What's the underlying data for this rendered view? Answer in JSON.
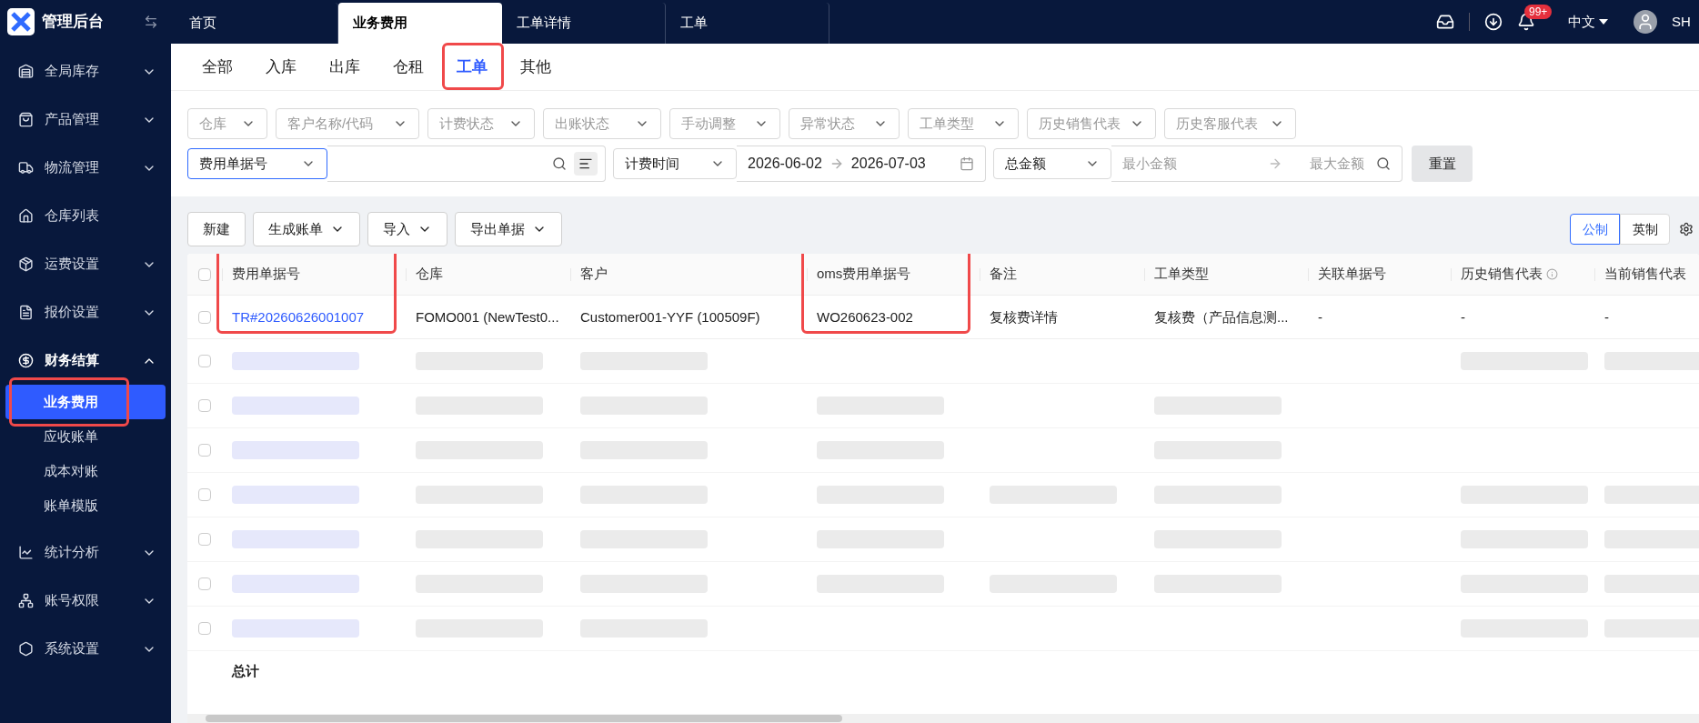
{
  "app": {
    "title": "管理后台"
  },
  "page_tabs": [
    {
      "label": "首页",
      "selected": false
    },
    {
      "label": "业务费用",
      "selected": true
    },
    {
      "label": "工单详情",
      "selected": false
    },
    {
      "label": "工单",
      "selected": false
    }
  ],
  "header": {
    "notification_count": "99+",
    "language": "中文",
    "user": "SH"
  },
  "sidebar": {
    "items": [
      {
        "label": "全局库存",
        "expandable": true,
        "expanded": false
      },
      {
        "label": "产品管理",
        "expandable": true,
        "expanded": false
      },
      {
        "label": "物流管理",
        "expandable": true,
        "expanded": false
      },
      {
        "label": "仓库列表",
        "expandable": false,
        "expanded": false
      },
      {
        "label": "运费设置",
        "expandable": true,
        "expanded": false
      },
      {
        "label": "报价设置",
        "expandable": true,
        "expanded": false
      },
      {
        "label": "财务结算",
        "expandable": true,
        "expanded": true,
        "children": [
          {
            "label": "业务费用",
            "selected": true,
            "highlighted": true
          },
          {
            "label": "应收账单",
            "selected": false,
            "highlighted": false
          },
          {
            "label": "成本对账",
            "selected": false,
            "highlighted": false
          },
          {
            "label": "账单模版",
            "selected": false,
            "highlighted": false
          }
        ]
      },
      {
        "label": "统计分析",
        "expandable": true,
        "expanded": false
      },
      {
        "label": "账号权限",
        "expandable": true,
        "expanded": false
      },
      {
        "label": "系统设置",
        "expandable": true,
        "expanded": false
      }
    ]
  },
  "category_tabs": [
    {
      "label": "全部",
      "selected": false,
      "highlighted": false
    },
    {
      "label": "入库",
      "selected": false,
      "highlighted": false
    },
    {
      "label": "出库",
      "selected": false,
      "highlighted": false
    },
    {
      "label": "仓租",
      "selected": false,
      "highlighted": false
    },
    {
      "label": "工单",
      "selected": true,
      "highlighted": true
    },
    {
      "label": "其他",
      "selected": false,
      "highlighted": false
    }
  ],
  "filters": [
    {
      "placeholder": "仓库"
    },
    {
      "placeholder": "客户名称/代码"
    },
    {
      "placeholder": "计费状态"
    },
    {
      "placeholder": "出账状态"
    },
    {
      "placeholder": "手动调整"
    },
    {
      "placeholder": "异常状态"
    },
    {
      "placeholder": "工单类型"
    },
    {
      "placeholder": "历史销售代表"
    },
    {
      "placeholder": "历史客服代表"
    }
  ],
  "search": {
    "field_select": "费用单据号",
    "time_select": "计费时间",
    "date_from": "2026-06-02",
    "date_to": "2026-07-03",
    "amount_select": "总金额",
    "min_placeholder": "最小金额",
    "max_placeholder": "最大金额",
    "reset": "重置"
  },
  "toolbar": {
    "buttons": [
      {
        "label": "新建",
        "dropdown": false
      },
      {
        "label": "生成账单",
        "dropdown": true
      },
      {
        "label": "导入",
        "dropdown": true
      },
      {
        "label": "导出单据",
        "dropdown": true
      }
    ],
    "units": [
      {
        "label": "公制",
        "selected": true
      },
      {
        "label": "英制",
        "selected": false
      }
    ]
  },
  "table": {
    "header_checked": false,
    "columns": [
      {
        "label": "费用单据号",
        "highlighted": true,
        "info": false
      },
      {
        "label": "仓库",
        "highlighted": false,
        "info": false
      },
      {
        "label": "客户",
        "highlighted": false,
        "info": false
      },
      {
        "label": "oms费用单据号",
        "highlighted": true,
        "info": false
      },
      {
        "label": "备注",
        "highlighted": false,
        "info": false
      },
      {
        "label": "工单类型",
        "highlighted": false,
        "info": false
      },
      {
        "label": "关联单据号",
        "highlighted": false,
        "info": false
      },
      {
        "label": "历史销售代表",
        "highlighted": false,
        "info": true
      },
      {
        "label": "当前销售代表",
        "highlighted": false,
        "info": false
      }
    ],
    "rows": [
      {
        "kind": "data",
        "checked": false,
        "cells": [
          "TR#20260626001007",
          "FOMO001 (NewTest0...",
          "Customer001-YYF (100509F)",
          "WO260623-002",
          "复核费详情",
          "复核费（产品信息测...",
          "-",
          "-",
          "-"
        ]
      },
      {
        "kind": "blurred",
        "checked": false
      },
      {
        "kind": "blurred",
        "checked": false
      },
      {
        "kind": "blurred",
        "checked": false
      },
      {
        "kind": "blurred",
        "checked": false
      },
      {
        "kind": "blurred",
        "checked": false
      },
      {
        "kind": "blurred",
        "checked": false
      },
      {
        "kind": "blurred",
        "checked": false
      }
    ],
    "total_label": "总计"
  }
}
